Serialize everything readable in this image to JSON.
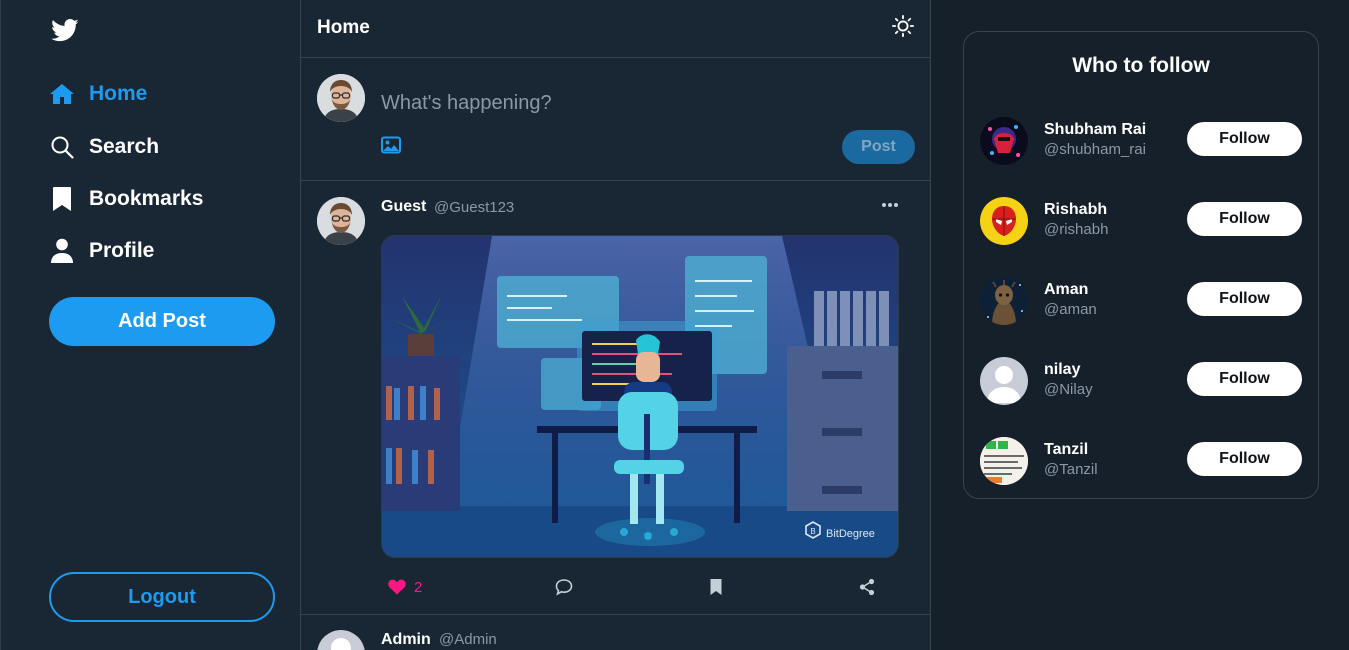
{
  "colors": {
    "accent": "#1d9bf0",
    "like": "#f91880",
    "background": "#15202b",
    "panel": "#192734"
  },
  "sidebar": {
    "logo_icon": "twitter-bird-icon",
    "items": [
      {
        "label": "Home",
        "icon": "home-icon"
      },
      {
        "label": "Search",
        "icon": "search-icon"
      },
      {
        "label": "Bookmarks",
        "icon": "bookmark-icon"
      },
      {
        "label": "Profile",
        "icon": "profile-icon"
      }
    ],
    "add_post_label": "Add Post",
    "logout_label": "Logout"
  },
  "main": {
    "title": "Home",
    "theme_icon": "sun-icon",
    "compose": {
      "placeholder": "What's happening?",
      "post_label": "Post"
    },
    "tweets": [
      {
        "name": "Guest",
        "handle": "@Guest123",
        "image_caption": "BitDegree",
        "likes": "2"
      },
      {
        "name": "Admin",
        "handle": "@Admin"
      }
    ]
  },
  "who_to_follow": {
    "title": "Who to follow",
    "follow_label": "Follow",
    "users": [
      {
        "name": "Shubham Rai",
        "handle": "@shubham_rai"
      },
      {
        "name": "Rishabh",
        "handle": "@rishabh"
      },
      {
        "name": "Aman",
        "handle": "@aman"
      },
      {
        "name": "nilay",
        "handle": "@Nilay"
      },
      {
        "name": "Tanzil",
        "handle": "@Tanzil"
      }
    ]
  }
}
